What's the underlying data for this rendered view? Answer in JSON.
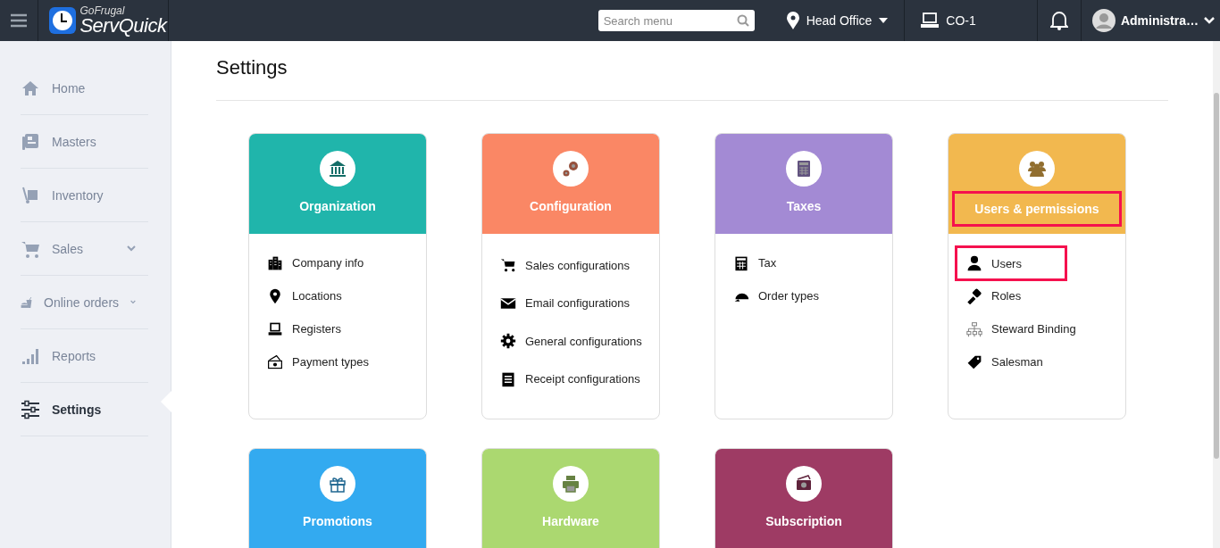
{
  "topbar": {
    "brand_small": "GoFrugal",
    "brand": "ServQuick",
    "search": {
      "placeholder": "Search menu"
    },
    "location": "Head Office",
    "register": "CO-1",
    "user": "Administra…"
  },
  "sidebar": {
    "items": [
      {
        "label": "Home",
        "selected": false,
        "expandable": false
      },
      {
        "label": "Masters",
        "selected": false,
        "expandable": false
      },
      {
        "label": "Inventory",
        "selected": false,
        "expandable": false
      },
      {
        "label": "Sales",
        "selected": false,
        "expandable": true
      },
      {
        "label": "Online orders",
        "selected": false,
        "expandable": true
      },
      {
        "label": "Reports",
        "selected": false,
        "expandable": false
      },
      {
        "label": "Settings",
        "selected": true,
        "expandable": false
      }
    ]
  },
  "page": {
    "title": "Settings"
  },
  "cards": [
    {
      "title": "Organization",
      "color": "#20b5ab",
      "highlighted": false,
      "items": [
        {
          "label": "Company info",
          "highlighted": false
        },
        {
          "label": "Locations",
          "highlighted": false
        },
        {
          "label": "Registers",
          "highlighted": false
        },
        {
          "label": "Payment types",
          "highlighted": false
        }
      ]
    },
    {
      "title": "Configuration",
      "color": "#fa8765",
      "highlighted": false,
      "items": [
        {
          "label": "Sales configurations",
          "highlighted": false
        },
        {
          "label": "Email configurations",
          "highlighted": false
        },
        {
          "label": "General configurations",
          "highlighted": false
        },
        {
          "label": "Receipt configurations",
          "highlighted": false
        }
      ]
    },
    {
      "title": "Taxes",
      "color": "#a38ad4",
      "highlighted": false,
      "items": [
        {
          "label": "Tax",
          "highlighted": false
        },
        {
          "label": "Order types",
          "highlighted": false
        }
      ]
    },
    {
      "title": "Users & permissions",
      "color": "#f2b84f",
      "highlighted": true,
      "items": [
        {
          "label": "Users",
          "highlighted": true
        },
        {
          "label": "Roles",
          "highlighted": false
        },
        {
          "label": "Steward Binding",
          "highlighted": false
        },
        {
          "label": "Salesman",
          "highlighted": false
        }
      ]
    },
    {
      "title": "Promotions",
      "color": "#33aaf0",
      "highlighted": false
    },
    {
      "title": "Hardware",
      "color": "#abd870",
      "highlighted": false
    },
    {
      "title": "Subscription",
      "color": "#9e3b64",
      "highlighted": false
    }
  ]
}
